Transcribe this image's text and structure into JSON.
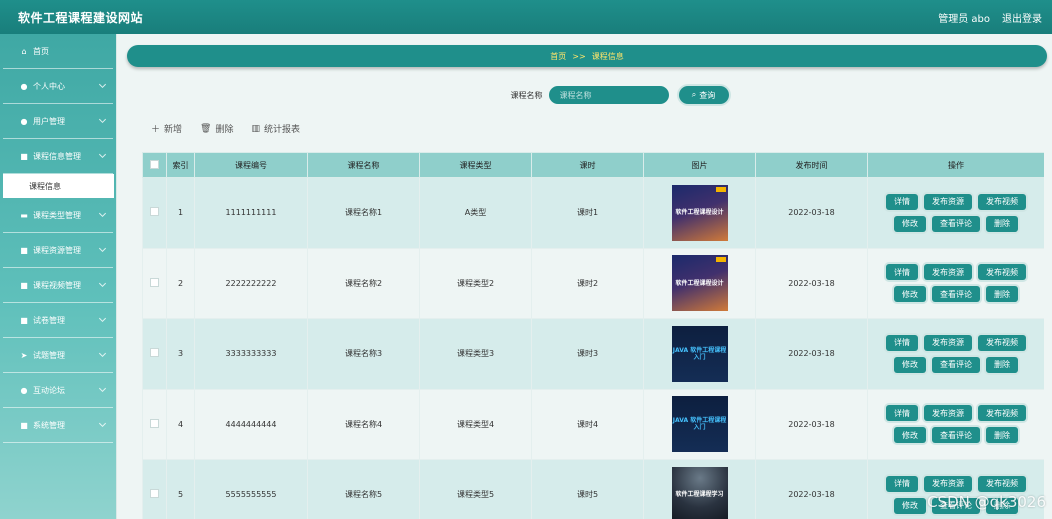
{
  "header": {
    "site_title": "软件工程课程建设网站",
    "admin_label": "管理员 abo",
    "logout_label": "退出登录"
  },
  "sidebar": {
    "items": [
      {
        "label": "首页",
        "icon": "home-icon",
        "glyph": "⌂"
      },
      {
        "label": "个人中心",
        "icon": "user-icon",
        "glyph": "●"
      },
      {
        "label": "用户管理",
        "icon": "pin-icon",
        "glyph": "●"
      },
      {
        "label": "课程信息管理",
        "icon": "grid-icon",
        "glyph": "■"
      },
      {
        "label": "课程类型管理",
        "icon": "briefcase-icon",
        "glyph": "▬"
      },
      {
        "label": "课程资源管理",
        "icon": "grid-icon",
        "glyph": "■"
      },
      {
        "label": "课程视频管理",
        "icon": "grid-icon",
        "glyph": "■"
      },
      {
        "label": "试卷管理",
        "icon": "grid-icon",
        "glyph": "■"
      },
      {
        "label": "试题管理",
        "icon": "send-icon",
        "glyph": "➤"
      },
      {
        "label": "互动论坛",
        "icon": "pin-icon",
        "glyph": "●"
      },
      {
        "label": "系统管理",
        "icon": "grid-icon",
        "glyph": "■"
      }
    ],
    "subitem": "课程信息"
  },
  "breadcrumb": {
    "home": "首页",
    "separator": ">>",
    "current": "课程信息"
  },
  "search": {
    "label": "课程名称",
    "placeholder": "课程名称",
    "button": "查询"
  },
  "toolbar": {
    "add": "新增",
    "delete": "删除",
    "stats": "统计报表"
  },
  "table": {
    "headers": [
      "索引",
      "课程编号",
      "课程名称",
      "课程类型",
      "课时",
      "图片",
      "发布时间",
      "操作"
    ],
    "rows": [
      {
        "index": "1",
        "code": "1111111111",
        "name": "课程名称1",
        "type": "A类型",
        "hours": "课时1",
        "date": "2022-03-18",
        "thumb_text": "软件工程课程设计",
        "thumb_style": "sunset"
      },
      {
        "index": "2",
        "code": "2222222222",
        "name": "课程名称2",
        "type": "课程类型2",
        "hours": "课时2",
        "date": "2022-03-18",
        "thumb_text": "软件工程课程设计",
        "thumb_style": "sunset"
      },
      {
        "index": "3",
        "code": "3333333333",
        "name": "课程名称3",
        "type": "课程类型3",
        "hours": "课时3",
        "date": "2022-03-18",
        "thumb_text": "JAVA 软件工程课程入门",
        "thumb_style": "java"
      },
      {
        "index": "4",
        "code": "4444444444",
        "name": "课程名称4",
        "type": "课程类型4",
        "hours": "课时4",
        "date": "2022-03-18",
        "thumb_text": "JAVA 软件工程课程入门",
        "thumb_style": "java"
      },
      {
        "index": "5",
        "code": "5555555555",
        "name": "课程名称5",
        "type": "课程类型5",
        "hours": "课时5",
        "date": "2022-03-18",
        "thumb_text": "软件工程课程学习",
        "thumb_style": "dark"
      }
    ],
    "actions_row1": [
      "详情",
      "发布资源",
      "发布视频"
    ],
    "actions_row2": [
      "修改",
      "查看评论",
      "删除"
    ]
  },
  "watermark": "CSDN @qk3026"
}
